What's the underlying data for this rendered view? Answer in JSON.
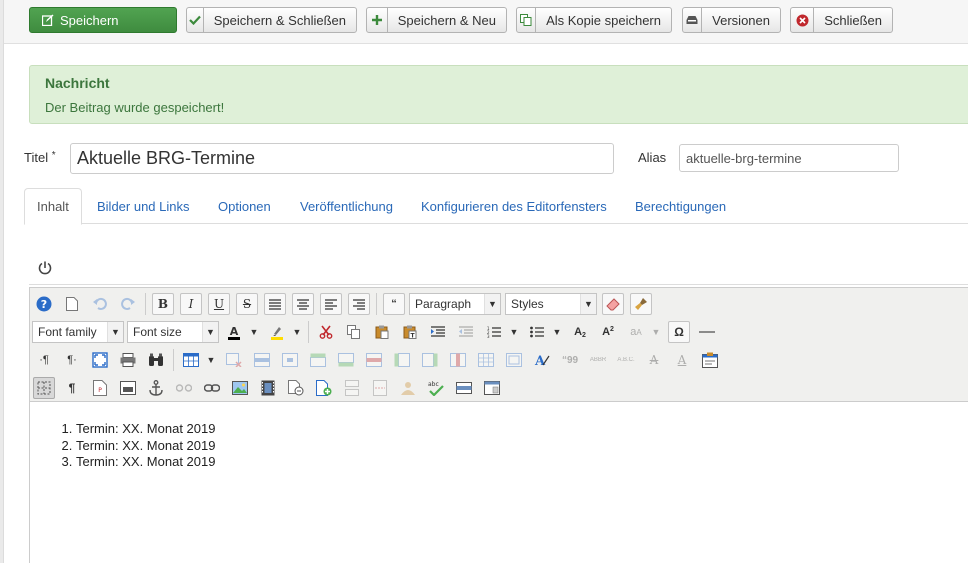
{
  "toolbar": {
    "save": "Speichern",
    "save_close": "Speichern & Schließen",
    "save_new": "Speichern & Neu",
    "save_copy": "Als Kopie speichern",
    "versions": "Versionen",
    "close": "Schließen"
  },
  "message": {
    "heading": "Nachricht",
    "text": "Der Beitrag wurde gespeichert!"
  },
  "form": {
    "title_label": "Titel",
    "required_mark": "*",
    "title_value": "Aktuelle BRG-Termine",
    "alias_label": "Alias",
    "alias_value": "aktuelle-brg-termine"
  },
  "tabs": [
    {
      "label": "Inhalt"
    },
    {
      "label": "Bilder und Links"
    },
    {
      "label": "Optionen"
    },
    {
      "label": "Veröffentlichung"
    },
    {
      "label": "Konfigurieren des Editorfensters"
    },
    {
      "label": "Berechtigungen"
    }
  ],
  "editor": {
    "format_select": "Paragraph",
    "styles_select": "Styles",
    "font_family": "Font family",
    "font_size": "Font size",
    "list_items": [
      "Termin: XX. Monat 2019",
      "Termin: XX. Monat 2019",
      "Termin: XX. Monat 2019"
    ]
  },
  "colors": {
    "primary": "#4a9a4a",
    "success_bg": "#dff0d8",
    "success_text": "#3c763d",
    "link": "#2a69b8"
  }
}
